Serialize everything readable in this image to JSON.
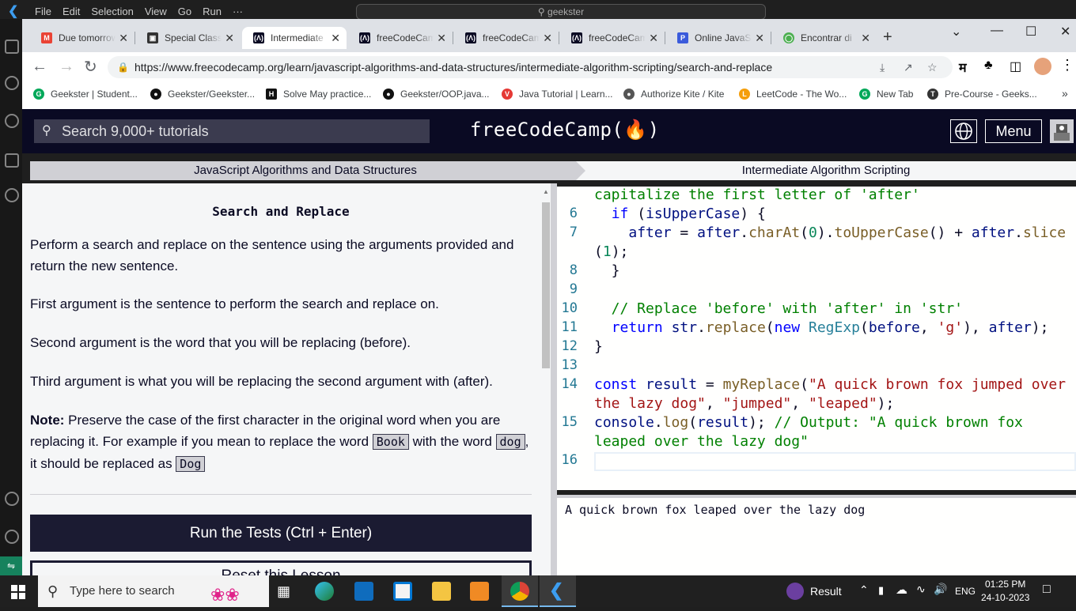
{
  "vscode": {
    "menu": [
      "File",
      "Edit",
      "Selection",
      "View",
      "Go",
      "Run",
      "···"
    ],
    "search": "geekster"
  },
  "chrome": {
    "tabs": [
      {
        "label": "Due tomorrow",
        "favicon": "gmail",
        "color": "#ea4335"
      },
      {
        "label": "Special Class",
        "favicon": "class",
        "color": "#333333"
      },
      {
        "label": "Intermediate",
        "favicon": "fcc",
        "color": "#0a0a23"
      },
      {
        "label": "freeCodeCamp",
        "favicon": "fcc",
        "color": "#0a0a23"
      },
      {
        "label": "freeCodeCamp",
        "favicon": "fcc",
        "color": "#0a0a23"
      },
      {
        "label": "freeCodeCamp",
        "favicon": "fcc",
        "color": "#0a0a23"
      },
      {
        "label": "Online JavaScript",
        "favicon": "p",
        "color": "#3b5bdb"
      },
      {
        "label": "Encontrar di",
        "favicon": "globe",
        "color": "#4caf50"
      }
    ],
    "url": "https://www.freecodecamp.org/learn/javascript-algorithms-and-data-structures/intermediate-algorithm-scripting/search-and-replace",
    "bookmarks": [
      {
        "label": "Geekster | Student...",
        "color": "#00a859",
        "glyph": "G"
      },
      {
        "label": "Geekster/Geekster...",
        "color": "#111111",
        "glyph": "●"
      },
      {
        "label": "Solve May practice...",
        "color": "#111111",
        "glyph": "H"
      },
      {
        "label": "Geekster/OOP.java...",
        "color": "#111111",
        "glyph": "●"
      },
      {
        "label": "Java Tutorial | Learn...",
        "color": "#e53935",
        "glyph": "V"
      },
      {
        "label": "Authorize Kite / Kite",
        "color": "#555555",
        "glyph": "●"
      },
      {
        "label": "LeetCode - The Wo...",
        "color": "#f59e0b",
        "glyph": "L"
      },
      {
        "label": "New Tab",
        "color": "#00a859",
        "glyph": "G"
      },
      {
        "label": "Pre-Course - Geeks...",
        "color": "#333333",
        "glyph": "T"
      }
    ]
  },
  "fcc": {
    "search_placeholder": "Search 9,000+ tutorials",
    "logo": "freeCodeCamp(🔥)",
    "menu_label": "Menu",
    "breadcrumb_left": "JavaScript Algorithms and Data Structures",
    "breadcrumb_right": "Intermediate Algorithm Scripting",
    "challenge_title": "Search and Replace",
    "p1": "Perform a search and replace on the sentence using the arguments provided and return the new sentence.",
    "p2": "First argument is the sentence to perform the search and replace on.",
    "p3": "Second argument is the word that you will be replacing (before).",
    "p4": "Third argument is what you will be replacing the second argument with (after).",
    "note_label": "Note:",
    "note_a": " Preserve the case of the first character in the original word when you are replacing it. For example if you mean to replace the word ",
    "code_book": "Book",
    "note_b": " with the word ",
    "code_dog": "dog",
    "note_c": ", it should be replaced as ",
    "code_Dog": "Dog",
    "run_button": "Run the Tests (Ctrl + Enter)",
    "reset_button": "Reset this Lesson",
    "console_output": "A quick brown fox leaped over the lazy dog"
  },
  "editor": {
    "line_numbers": [
      "6",
      "7",
      "8",
      "9",
      "10",
      "11",
      "12",
      "13",
      "14",
      "15",
      "16"
    ]
  },
  "taskbar": {
    "search_placeholder": "Type here to search",
    "result_label": "Result",
    "lang": "ENG",
    "time": "01:25 PM",
    "date": "24-10-2023"
  }
}
